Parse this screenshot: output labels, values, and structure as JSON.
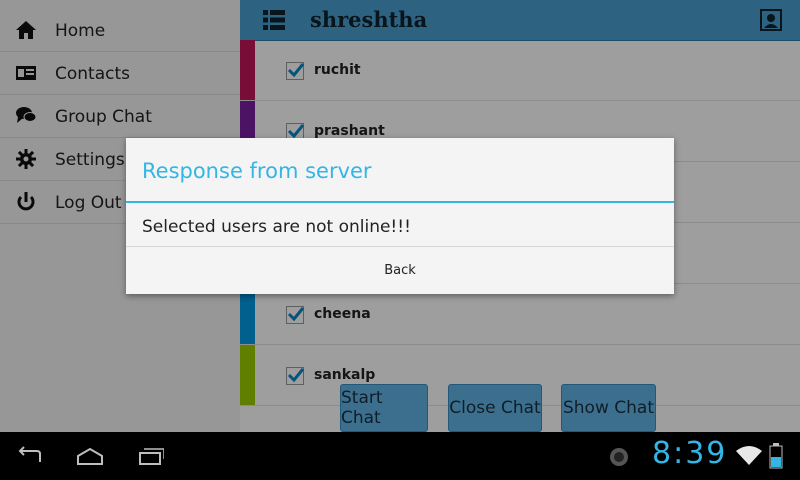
{
  "drawer": {
    "items": [
      {
        "label": "Home",
        "icon": "home-icon"
      },
      {
        "label": "Contacts",
        "icon": "contact-card-icon"
      },
      {
        "label": "Group Chat",
        "icon": "chat-bubbles-icon"
      },
      {
        "label": "Settings",
        "icon": "gear-icon"
      },
      {
        "label": "Log Out",
        "icon": "power-icon"
      }
    ]
  },
  "actionbar": {
    "title": "shreshtha",
    "color": "#4a9fcf"
  },
  "users": [
    {
      "name": "ruchit",
      "color": "#c2185b",
      "checked": true
    },
    {
      "name": "prashant",
      "color": "#7b1fa2",
      "checked": true
    },
    {
      "name": "",
      "color": "#5c6bc0",
      "checked": true
    },
    {
      "name": "",
      "color": "#1e88e5",
      "checked": true
    },
    {
      "name": "cheena",
      "color": "#039be5",
      "checked": true
    },
    {
      "name": "sankalp",
      "color": "#9ccc00",
      "checked": true
    }
  ],
  "buttons": {
    "start_chat": "Start Chat",
    "close_chat": "Close Chat",
    "show_chat": "Show Chat"
  },
  "dialog": {
    "title": "Response from server",
    "message": "Selected users are not online!!!",
    "back_label": "Back",
    "accent": "#33b5e5"
  },
  "status": {
    "time": "8:39"
  }
}
